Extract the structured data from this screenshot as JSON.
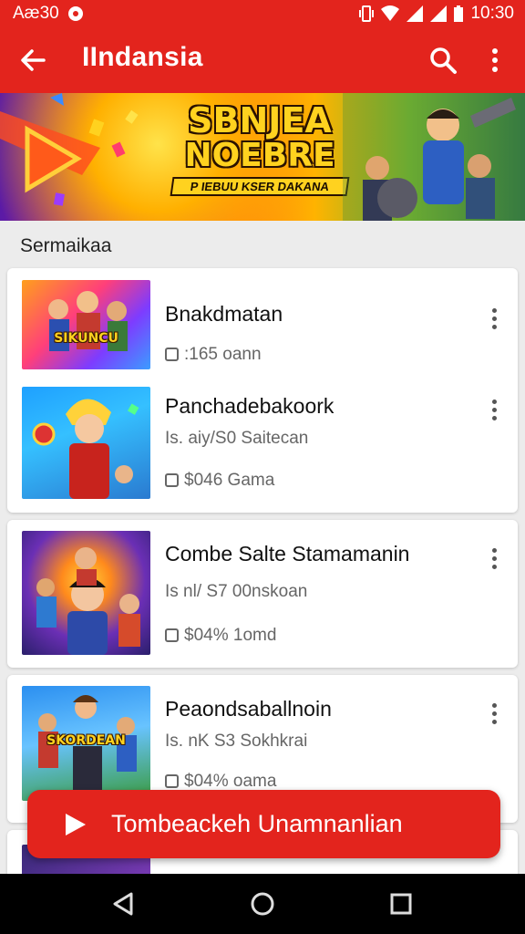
{
  "status_bar": {
    "left_text": "Aæ30",
    "time": "10:30"
  },
  "app_bar": {
    "title": "IIndansia"
  },
  "banner": {
    "headline_line1": "SBNJEA",
    "headline_line2": "NOEBRE",
    "subtitle": "P IEBUU KSER DAKANA"
  },
  "section": {
    "label": "Sermaikaa"
  },
  "items": [
    {
      "title": "Bnakdmatan",
      "thumb_text": "SIKUNCU",
      "meta": [
        ":165 oann"
      ]
    },
    {
      "title": "Panchadebakoork",
      "thumb_text": "",
      "meta": [
        "Is. aiy/S0 Saitecan",
        "$046 Gama"
      ]
    },
    {
      "title": "Combe Salte Stamamanin",
      "thumb_text": "",
      "meta": [
        "Is nl/ S7 00nskoan",
        "$04% 1omd"
      ]
    },
    {
      "title": "Peaondsaballnoin",
      "thumb_text": "SKORDEAN",
      "meta": [
        "Is. nK S3 Sokhkrai",
        "$04% oama"
      ]
    }
  ],
  "cta": {
    "label": "Tombeackeh Unamnanlian"
  },
  "icons": [
    "back-arrow-icon",
    "search-icon",
    "more-vert-icon",
    "clipboard-icon",
    "play-icon",
    "nav-back-icon",
    "nav-home-icon",
    "nav-recents-icon"
  ],
  "colors": {
    "primary_red": "#e3241d",
    "background": "#ececec",
    "card": "#ffffff"
  }
}
